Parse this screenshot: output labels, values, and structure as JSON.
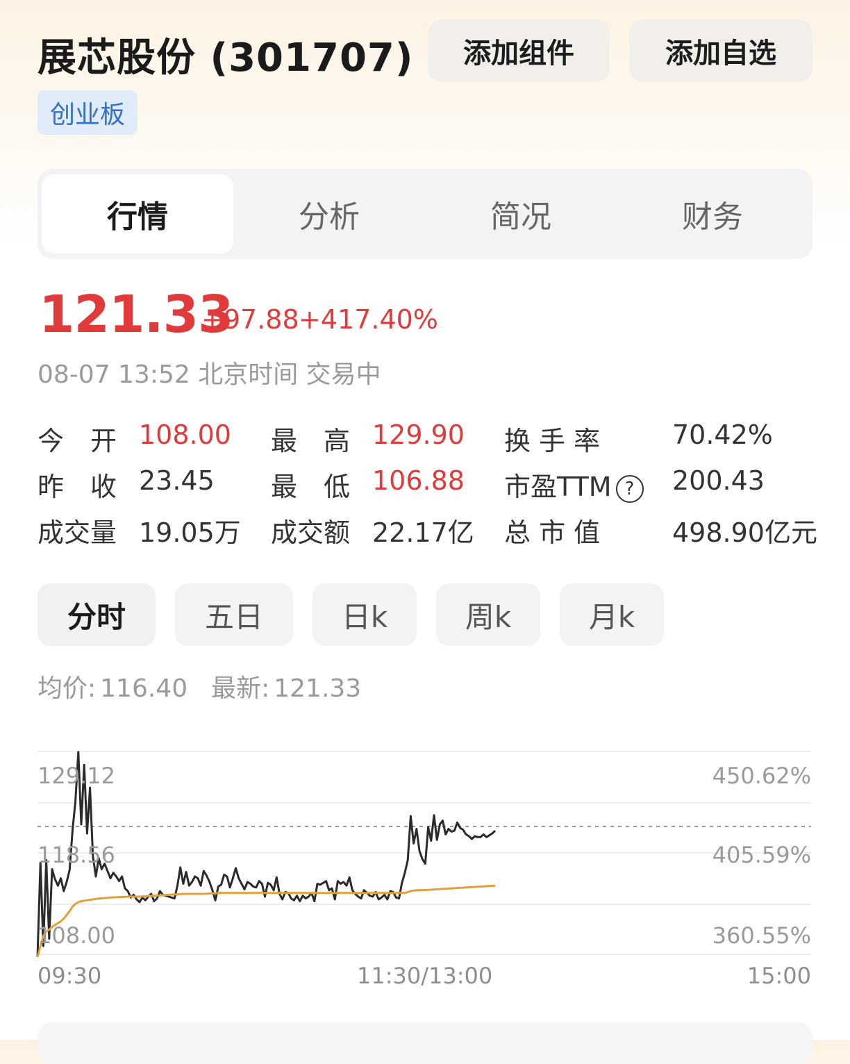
{
  "header": {
    "title": "展芯股份 (301707)",
    "add_widget_label": "添加组件",
    "add_watchlist_label": "添加自选",
    "market_badge": "创业板"
  },
  "tabs": [
    "行情",
    "分析",
    "简况",
    "财务"
  ],
  "quote": {
    "price": "121.33",
    "change": "+97.88",
    "change_pct": "+417.40%",
    "time_status": "08-07 13:52 北京时间 交易中",
    "up_color": "#e03a3a"
  },
  "stats": {
    "open_label": "今　开",
    "open_value": "108.00",
    "high_label": "最　高",
    "high_value": "129.90",
    "turnover_label": "换 手 率",
    "turnover_value": "70.42%",
    "prev_close_label": "昨　收",
    "prev_close_value": "23.45",
    "low_label": "最　低",
    "low_value": "106.88",
    "pe_label": "市盈TTM",
    "pe_value": "200.43",
    "volume_label": "成交量",
    "volume_value": "19.05万",
    "amount_label": "成交额",
    "amount_value": "22.17亿",
    "mcap_label": "总 市 值",
    "mcap_value": "498.90亿元"
  },
  "period_tabs": [
    "分时",
    "五日",
    "日k",
    "周k",
    "月k"
  ],
  "legend": {
    "avg_label": "均价:",
    "avg_value": "116.40",
    "latest_label": "最新:",
    "latest_value": "121.33"
  },
  "chart_data": {
    "type": "line",
    "y_left_ticks": [
      "129.12",
      "118.56",
      "108.00"
    ],
    "y_right_ticks": [
      "450.62%",
      "405.59%",
      "360.55%"
    ],
    "x_ticks": [
      "09:30",
      "11:30/13:00",
      "15:00"
    ],
    "ylim": [
      108.0,
      129.12
    ],
    "prev_close_ref": 121.9,
    "series": [
      {
        "color": "#2b2b2b",
        "values": [
          108.0,
          118.3,
          109.2,
          118.6,
          110.0,
          117.6,
          116.5,
          115.8,
          116.6,
          115.2,
          116.2,
          117.5,
          121.8,
          125.0,
          130.4,
          122.5,
          129.0,
          121.5,
          126.5,
          119.0,
          116.8,
          118.8,
          117.6,
          118.2,
          117.4,
          116.6,
          117.2,
          116.8,
          116.3,
          116.8,
          115.5,
          115.2,
          114.5,
          114.8,
          114.3,
          114.0,
          114.5,
          114.2,
          114.6,
          114.9,
          114.1,
          114.4,
          115.2,
          114.8,
          114.7,
          114.6,
          114.5,
          114.4,
          115.8,
          117.8,
          116.0,
          117.3,
          115.8,
          116.2,
          116.8,
          116.6,
          115.8,
          117.4,
          116.9,
          116.2,
          115.3,
          114.2,
          115.7,
          115.9,
          117.0,
          116.8,
          115.6,
          116.6,
          117.7,
          116.6,
          116.0,
          115.4,
          116.2,
          116.0,
          115.7,
          115.6,
          116.3,
          116.0,
          114.6,
          116.1,
          115.9,
          115.3,
          116.7,
          114.9,
          114.3,
          115.1,
          115.0,
          114.4,
          114.2,
          114.7,
          114.1,
          114.7,
          114.4,
          114.6,
          115.0,
          114.1,
          116.0,
          115.9,
          116.1,
          116.3,
          115.3,
          115.5,
          114.3,
          116.3,
          116.0,
          116.2,
          115.8,
          116.7,
          115.3,
          114.9,
          114.6,
          114.4,
          115.3,
          115.0,
          114.7,
          114.6,
          115.1,
          114.3,
          114.5,
          114.8,
          114.3,
          115.2,
          115.1,
          114.5,
          114.4,
          116.1,
          117.2,
          118.6,
          123.4,
          120.4,
          122.0,
          119.6,
          118.7,
          118.2,
          122.2,
          120.7,
          123.5,
          120.8,
          122.5,
          122.9,
          121.4,
          122.0,
          121.7,
          121.8,
          122.7,
          122.1,
          121.9,
          121.4,
          121.2,
          120.9,
          121.2,
          121.1,
          121.1,
          121.4,
          121.1,
          121.3,
          121.5,
          121.8
        ]
      },
      {
        "color": "#e3a03a",
        "values": [
          108.0,
          109.2,
          110.3,
          110.8,
          111.0,
          111.3,
          111.5,
          111.7,
          111.9,
          112.2,
          112.6,
          113.0,
          113.5,
          113.8,
          114.0,
          114.1,
          114.15,
          114.2,
          114.25,
          114.3,
          114.35,
          114.4,
          114.42,
          114.45,
          114.48,
          114.5,
          114.52,
          114.54,
          114.55,
          114.56,
          114.58,
          114.6,
          114.6,
          114.6,
          114.6,
          114.6,
          114.62,
          114.64,
          114.66,
          114.68,
          114.7,
          114.72,
          114.74,
          114.76,
          114.78,
          114.8,
          114.82,
          114.84,
          114.86,
          114.88,
          114.9,
          114.9,
          114.9,
          114.9,
          114.9,
          114.9,
          114.9,
          114.9,
          114.92,
          114.94,
          114.96,
          114.98,
          115.0,
          115.0,
          115.0,
          115.0,
          115.0,
          115.0,
          115.0,
          115.0,
          115.0,
          115.0,
          115.0,
          115.0,
          115.0,
          115.0,
          115.0,
          115.0,
          115.0,
          115.0,
          115.0,
          115.0,
          115.0,
          115.0,
          115.0,
          115.0,
          115.0,
          115.0,
          115.0,
          115.0,
          115.0,
          115.0,
          115.0,
          115.0,
          115.0,
          115.0,
          115.0,
          115.0,
          115.0,
          115.0,
          115.0,
          115.0,
          115.0,
          115.0,
          115.0,
          115.0,
          115.0,
          115.0,
          115.0,
          115.0,
          115.0,
          115.0,
          115.0,
          115.0,
          115.0,
          115.0,
          115.0,
          115.0,
          115.0,
          115.0,
          115.0,
          115.0,
          115.0,
          115.0,
          115.0,
          115.0,
          115.0,
          115.1,
          115.2,
          115.25,
          115.3,
          115.3,
          115.3,
          115.32,
          115.34,
          115.36,
          115.38,
          115.4,
          115.42,
          115.44,
          115.46,
          115.48,
          115.5,
          115.52,
          115.54,
          115.56,
          115.58,
          115.6,
          115.62,
          115.64,
          115.66,
          115.68,
          115.7,
          115.72,
          115.74,
          115.76,
          115.78,
          115.8
        ]
      }
    ]
  }
}
